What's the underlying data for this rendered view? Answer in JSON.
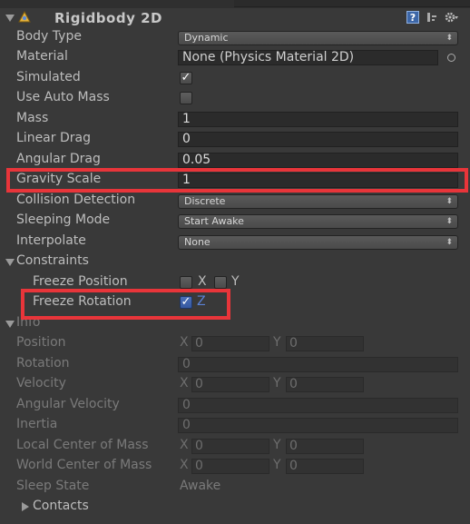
{
  "component": {
    "title": "Rigidbody 2D",
    "help_glyph": "?",
    "icons": [
      "rigidbody2d-icon",
      "help-icon",
      "preset-icon",
      "gear-icon"
    ]
  },
  "fields": {
    "body_type": {
      "label": "Body Type",
      "value": "Dynamic"
    },
    "material": {
      "label": "Material",
      "value": "None (Physics Material 2D)"
    },
    "simulated": {
      "label": "Simulated",
      "checked": true
    },
    "use_auto_mass": {
      "label": "Use Auto Mass",
      "checked": false
    },
    "mass": {
      "label": "Mass",
      "value": "1"
    },
    "linear_drag": {
      "label": "Linear Drag",
      "value": "0"
    },
    "angular_drag": {
      "label": "Angular Drag",
      "value": "0.05"
    },
    "gravity_scale": {
      "label": "Gravity Scale",
      "value": "1"
    },
    "collision_detection": {
      "label": "Collision Detection",
      "value": "Discrete"
    },
    "sleeping_mode": {
      "label": "Sleeping Mode",
      "value": "Start Awake"
    },
    "interpolate": {
      "label": "Interpolate",
      "value": "None"
    }
  },
  "constraints": {
    "label": "Constraints",
    "freeze_position": {
      "label": "Freeze Position",
      "x_label": "X",
      "y_label": "Y",
      "x_checked": false,
      "y_checked": false
    },
    "freeze_rotation": {
      "label": "Freeze Rotation",
      "z_label": "Z",
      "z_checked": true
    }
  },
  "info": {
    "label": "Info",
    "position": {
      "label": "Position",
      "x_label": "X",
      "x": "0",
      "y_label": "Y",
      "y": "0"
    },
    "rotation": {
      "label": "Rotation",
      "value": "0"
    },
    "velocity": {
      "label": "Velocity",
      "x_label": "X",
      "x": "0",
      "y_label": "Y",
      "y": "0"
    },
    "angular_velocity": {
      "label": "Angular Velocity",
      "value": "0"
    },
    "inertia": {
      "label": "Inertia",
      "value": "0"
    },
    "local_center_of_mass": {
      "label": "Local Center of Mass",
      "x_label": "X",
      "x": "0",
      "y_label": "Y",
      "y": "0"
    },
    "world_center_of_mass": {
      "label": "World Center of Mass",
      "x_label": "X",
      "x": "0",
      "y_label": "Y",
      "y": "0"
    },
    "sleep_state": {
      "label": "Sleep State",
      "value": "Awake"
    },
    "contacts": {
      "label": "Contacts"
    }
  },
  "colors": {
    "highlight": "#e8353a",
    "panel_bg": "#393939",
    "field_bg": "#2b2b2b",
    "checkbox_accent": "#3658a0"
  }
}
